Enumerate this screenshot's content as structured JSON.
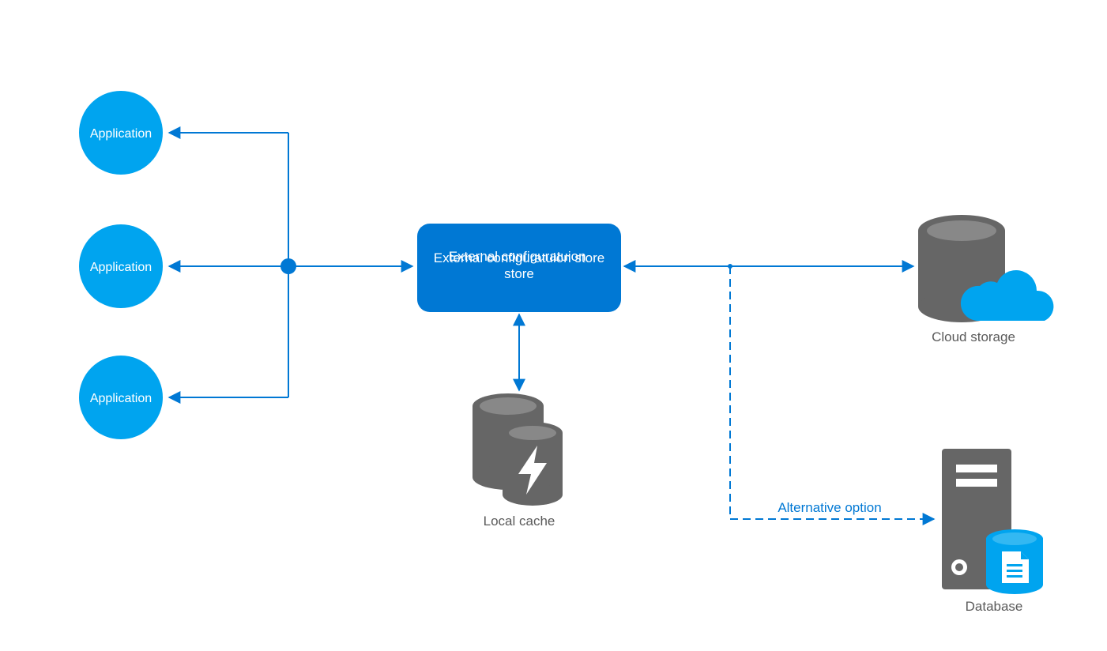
{
  "nodes": {
    "app1": "Application",
    "app2": "Application",
    "app3": "Application",
    "config_store": "External configuratuion store",
    "local_cache": "Local cache",
    "cloud_storage": "Cloud storage",
    "database": "Database"
  },
  "edges": {
    "alt_option": "Alternative option"
  }
}
